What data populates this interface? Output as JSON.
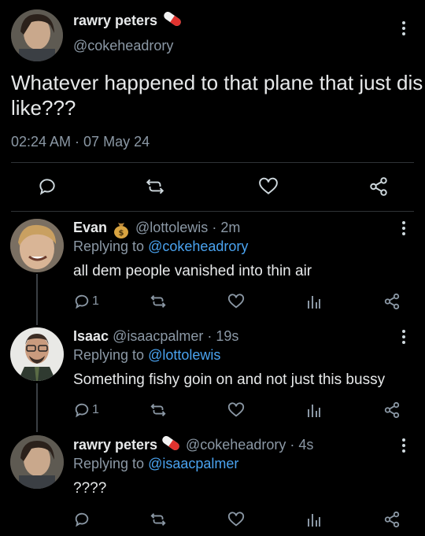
{
  "main_tweet": {
    "display_name": "rawry peters",
    "handle": "@cokeheadrory",
    "text_line1": "Whatever happened to that plane that just dis",
    "text_line2": "like???",
    "timestamp": "02:24 AM · 07 May 24"
  },
  "replies": [
    {
      "display_name": "Evan",
      "handle": "@lottolewis",
      "time": "· 2m",
      "replying_label": "Replying to",
      "replying_to": "@cokeheadrory",
      "text": "all dem people vanished into thin air",
      "reply_count": "1"
    },
    {
      "display_name": "Isaac",
      "handle": "@isaacpalmer",
      "time": "· 19s",
      "replying_label": "Replying to",
      "replying_to": "@lottolewis",
      "text": "Something fishy goin on and not just this bussy",
      "reply_count": "1"
    },
    {
      "display_name": "rawry peters",
      "handle": "@cokeheadrory",
      "time": "· 4s",
      "replying_label": "Replying to",
      "replying_to": "@isaacpalmer",
      "text": "????",
      "reply_count": ""
    }
  ],
  "colors": {
    "background": "#000000",
    "link": "#4aa3f0",
    "muted": "#8b98a5"
  }
}
